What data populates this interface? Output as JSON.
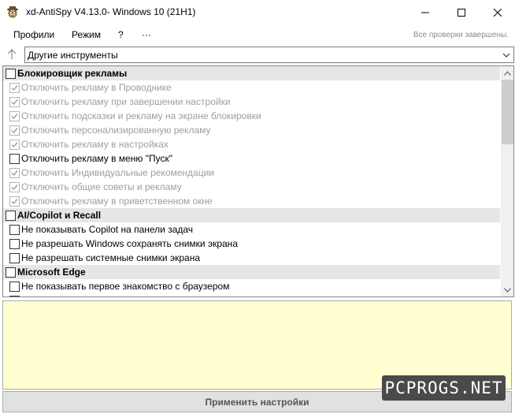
{
  "window": {
    "title": "xd-AntiSpy V4.13.0- Windows 10 (21H1)",
    "icon": "spy-mascot-icon",
    "controls": [
      "minimize-icon",
      "maximize-icon",
      "close-icon"
    ]
  },
  "menu": {
    "items": [
      "Профили",
      "Режим",
      "?",
      "···"
    ],
    "status": "Все проверки завершены."
  },
  "toolbar": {
    "up_icon": "arrow-up-icon",
    "category": "Другие инструменты",
    "dropdown_icon": "chevron-down-icon"
  },
  "list": {
    "rows": [
      {
        "type": "header",
        "label": "Блокировщик рекламы",
        "checked": false,
        "disabled": false
      },
      {
        "type": "item",
        "label": "Отключить рекламу в Проводнике",
        "checked": true,
        "disabled": true
      },
      {
        "type": "item",
        "label": "Отключить рекламу при завершении настройки",
        "checked": true,
        "disabled": true
      },
      {
        "type": "item",
        "label": "Отключить подсказки и рекламу на экране блокировки",
        "checked": true,
        "disabled": true
      },
      {
        "type": "item",
        "label": "Отключить персонализированную рекламу",
        "checked": true,
        "disabled": true
      },
      {
        "type": "item",
        "label": "Отключить рекламу в настройках",
        "checked": true,
        "disabled": true
      },
      {
        "type": "item",
        "label": "Отключить рекламу в меню \"Пуск\"",
        "checked": false,
        "disabled": false
      },
      {
        "type": "item",
        "label": "Отключить Индивидуальные рекомендации",
        "checked": true,
        "disabled": true
      },
      {
        "type": "item",
        "label": "Отключить общие советы и рекламу",
        "checked": true,
        "disabled": true
      },
      {
        "type": "item",
        "label": "Отключить рекламу в приветственном окне",
        "checked": true,
        "disabled": true
      },
      {
        "type": "header",
        "label": "AI/Copilot и Recall",
        "checked": false,
        "disabled": false
      },
      {
        "type": "item",
        "label": "Не показывать Copilot на панели задач",
        "checked": false,
        "disabled": false
      },
      {
        "type": "item",
        "label": "Не разрешать Windows сохранять снимки экрана",
        "checked": false,
        "disabled": false
      },
      {
        "type": "item",
        "label": "Не разрешать системные снимки экрана",
        "checked": false,
        "disabled": false
      },
      {
        "type": "header",
        "label": "Microsoft Edge",
        "checked": false,
        "disabled": false
      },
      {
        "type": "item",
        "label": "Не показывать первое знакомство с браузером",
        "checked": false,
        "disabled": false
      },
      {
        "type": "item",
        "label": "",
        "checked": false,
        "disabled": false
      }
    ]
  },
  "apply_button": "Применить настройки",
  "watermark": "PCPROGS.NET",
  "colors": {
    "description_bg": "#ffffd2",
    "header_bg": "#e6e6e6",
    "disabled_text": "#9e9e9e"
  }
}
